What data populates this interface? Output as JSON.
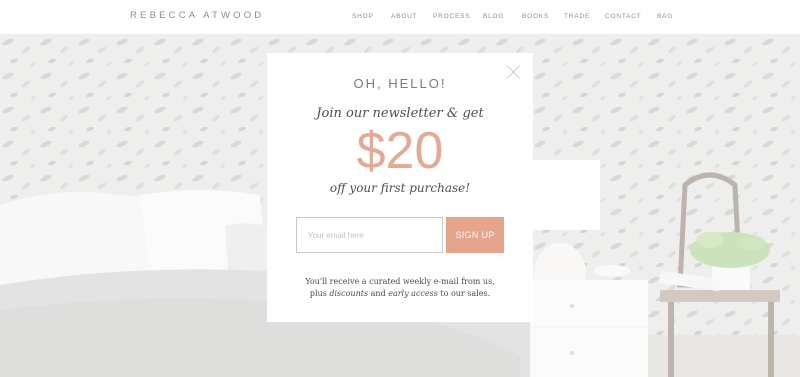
{
  "brand": "REBECCA ATWOOD",
  "nav": [
    "SHOP",
    "ABOUT",
    "PROCESS",
    "BLOG",
    "BOOKS",
    "TRADE",
    "CONTACT",
    "BAG"
  ],
  "popup": {
    "greeting": "OH, HELLO!",
    "intro": "Join our newsletter & get",
    "amount": "$20",
    "subtext": "off your first purchase!",
    "email_placeholder": "Your email here",
    "signup_label": "SIGN UP",
    "footer_line1": "You'll receive a curated weekly e-mail from us,",
    "footer_line2_prefix": "plus",
    "footer_line2_discounts": "discounts",
    "footer_line2_and": "and",
    "footer_line2_early_access": "early access",
    "footer_line2_suffix": "to our sales.",
    "close_icon": "close-icon"
  },
  "colors": {
    "accent": "#e7a48c",
    "amount": "#e3a992",
    "text_dark": "#4e4e4e",
    "nav_text": "#8f8f8f"
  }
}
